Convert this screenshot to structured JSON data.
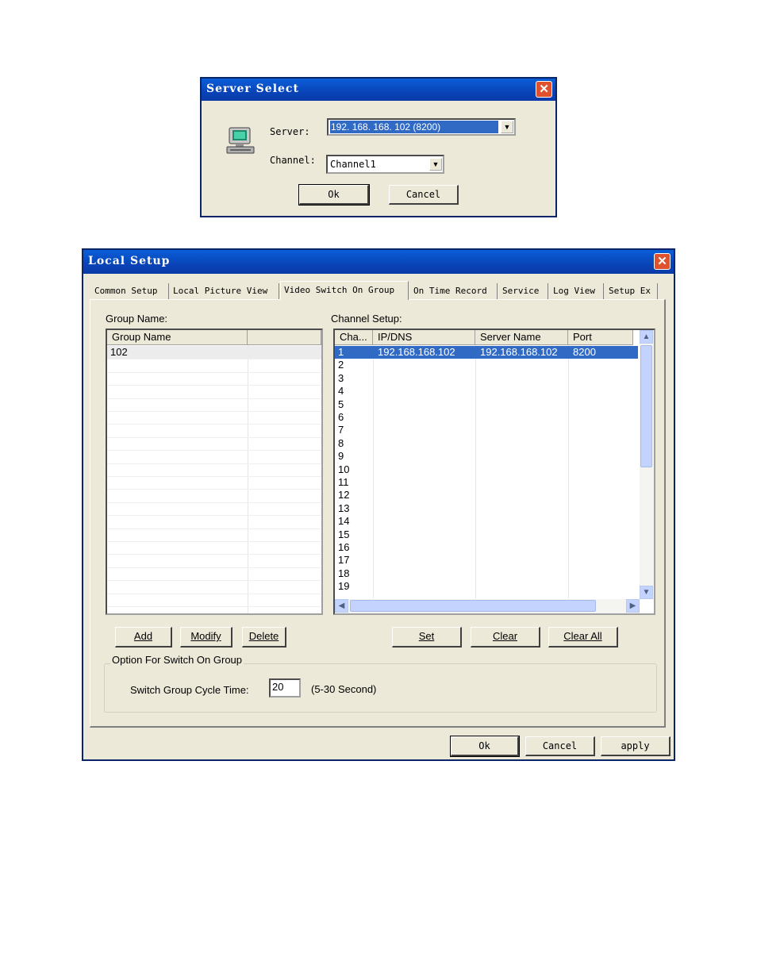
{
  "server_select": {
    "title": "Server Select",
    "server_label": "Server:",
    "server_value": "192. 168. 168. 102 (8200)",
    "channel_label": "Channel:",
    "channel_value": "Channel1",
    "ok": "Ok",
    "cancel": "Cancel"
  },
  "local_setup": {
    "title": "Local Setup",
    "tabs": [
      {
        "label": "Common Setup"
      },
      {
        "label": "Local Picture View"
      },
      {
        "label": "Video Switch On Group"
      },
      {
        "label": "On Time Record"
      },
      {
        "label": "Service"
      },
      {
        "label": "Log View"
      },
      {
        "label": "Setup Ex"
      }
    ],
    "group_name_label": "Group Name:",
    "group_list": {
      "header": "Group Name",
      "rows": [
        "102"
      ]
    },
    "channel_setup_label": "Channel Setup:",
    "channel_list": {
      "headers": [
        "Cha...",
        "IP/DNS",
        "Server Name",
        "Port"
      ],
      "selected": {
        "cha": "1",
        "ip": "192.168.168.102",
        "server": "192.168.168.102",
        "port": "8200"
      },
      "channels": [
        "2",
        "3",
        "4",
        "5",
        "6",
        "7",
        "8",
        "9",
        "10",
        "11",
        "12",
        "13",
        "14",
        "15",
        "16",
        "17",
        "18",
        "19"
      ]
    },
    "buttons": {
      "add": "Add",
      "modify": "Modify",
      "delete": "Delete",
      "set": "Set",
      "clear": "Clear",
      "clear_all": "Clear All"
    },
    "option_group": {
      "title": "Option For Switch On Group",
      "cycle_label": "Switch Group Cycle Time:",
      "cycle_value": "20",
      "cycle_hint": "(5-30 Second)"
    },
    "footer": {
      "ok": "Ok",
      "cancel": "Cancel",
      "apply": "apply"
    }
  }
}
